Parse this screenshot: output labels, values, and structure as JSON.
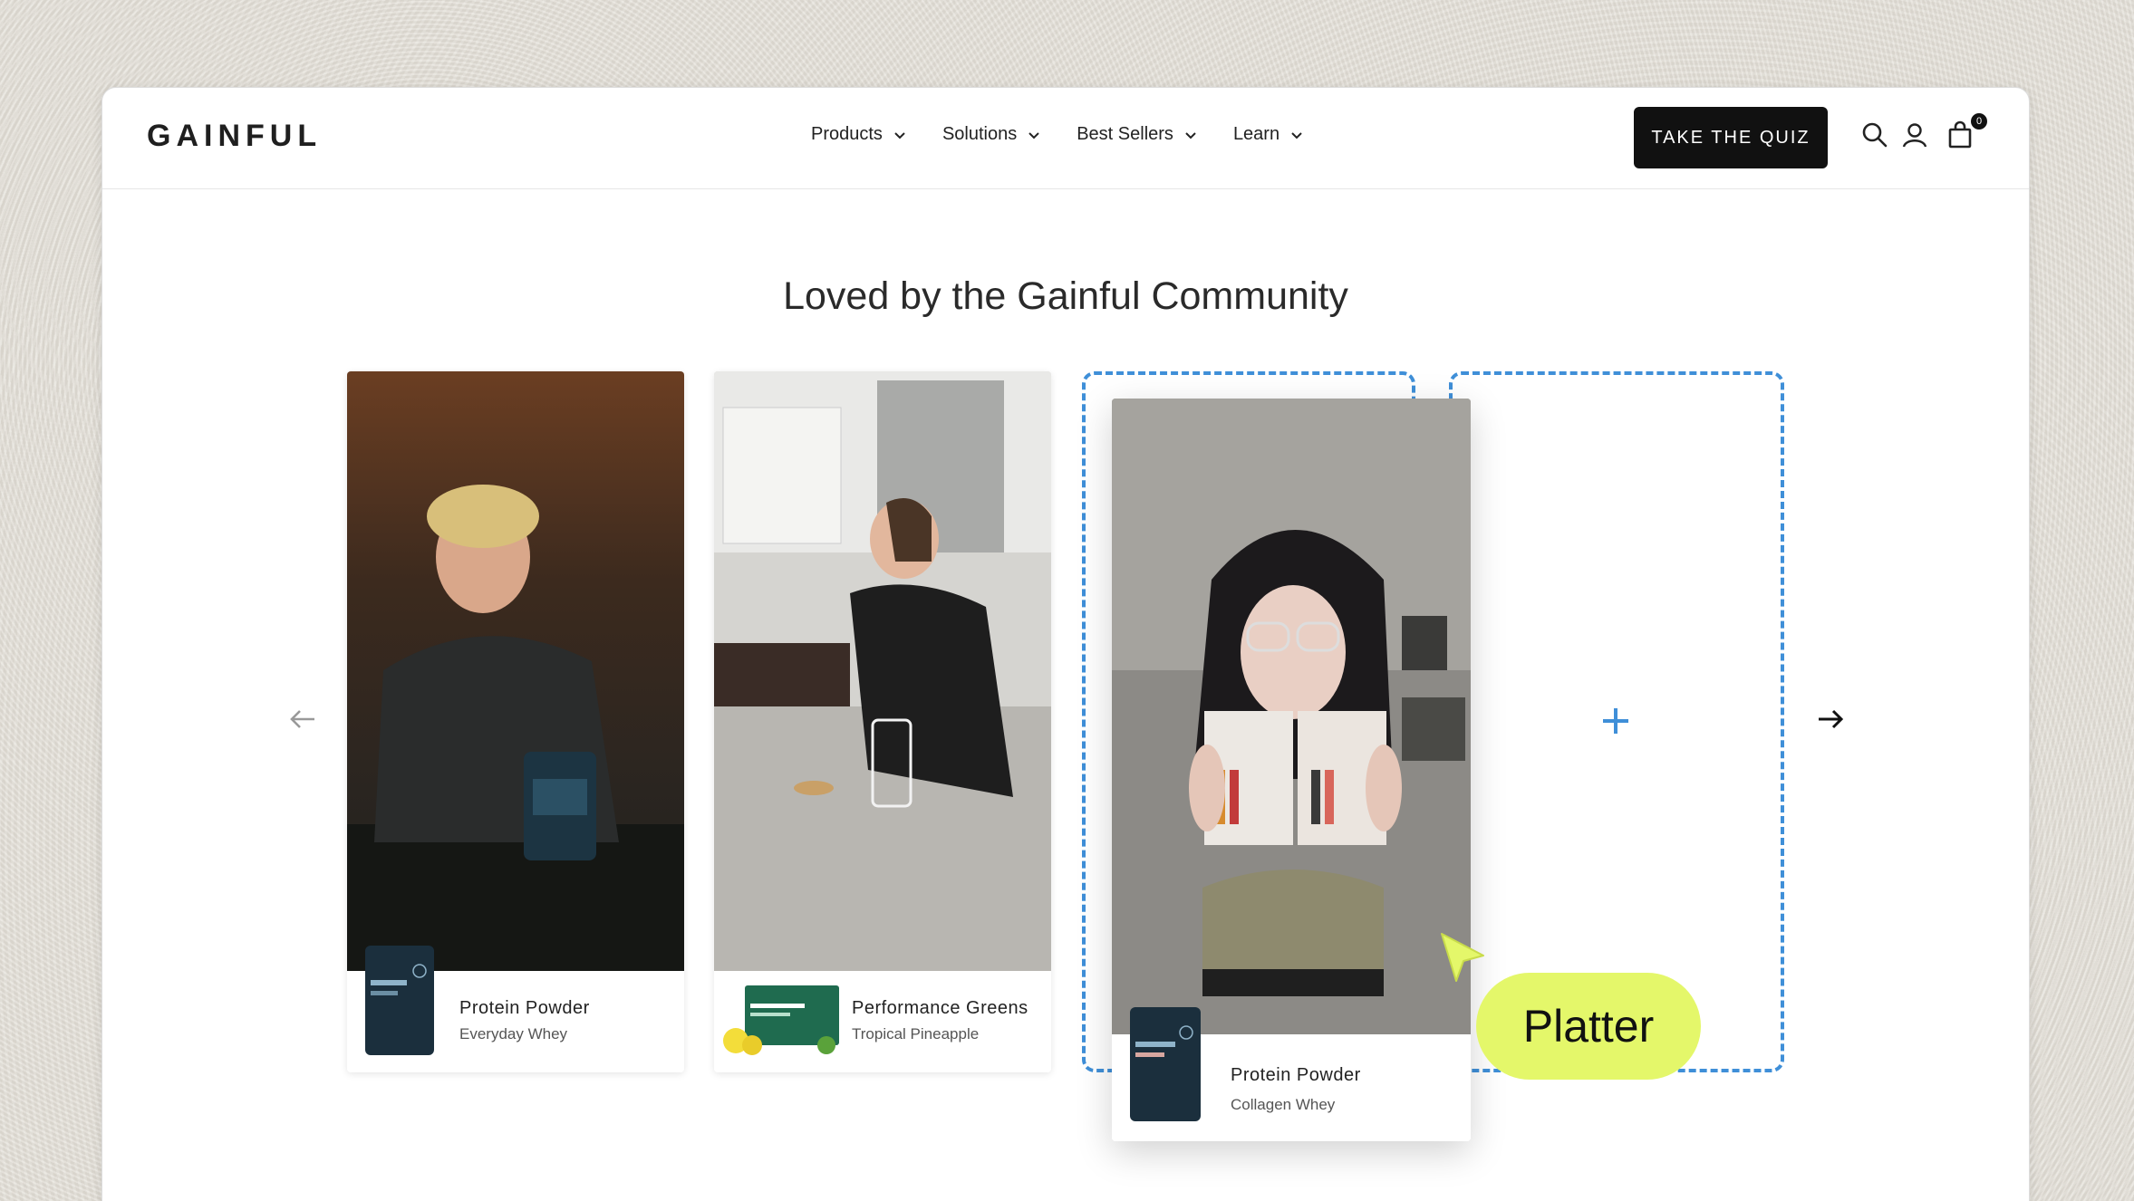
{
  "header": {
    "logo": "GAINFUL",
    "nav": [
      {
        "label": "Products"
      },
      {
        "label": "Solutions"
      },
      {
        "label": "Best Sellers"
      },
      {
        "label": "Learn"
      }
    ],
    "quiz_label": "TAKE THE QUIZ",
    "cart_count": "0",
    "icons": [
      "search-icon",
      "account-icon",
      "cart-icon"
    ]
  },
  "section": {
    "title": "Loved by the Gainful Community"
  },
  "cards": [
    {
      "title": "Protein Powder",
      "subtitle": "Everyday Whey"
    },
    {
      "title": "Performance Greens",
      "subtitle": "Tropical Pineapple"
    },
    {
      "title": "Protein Powder",
      "subtitle": "Collagen Whey"
    }
  ],
  "overlay": {
    "label": "Platter"
  },
  "colors": {
    "dashed_outline": "#3f8fd8",
    "platter_pill": "#e4f76a",
    "quiz_button": "#111111"
  }
}
